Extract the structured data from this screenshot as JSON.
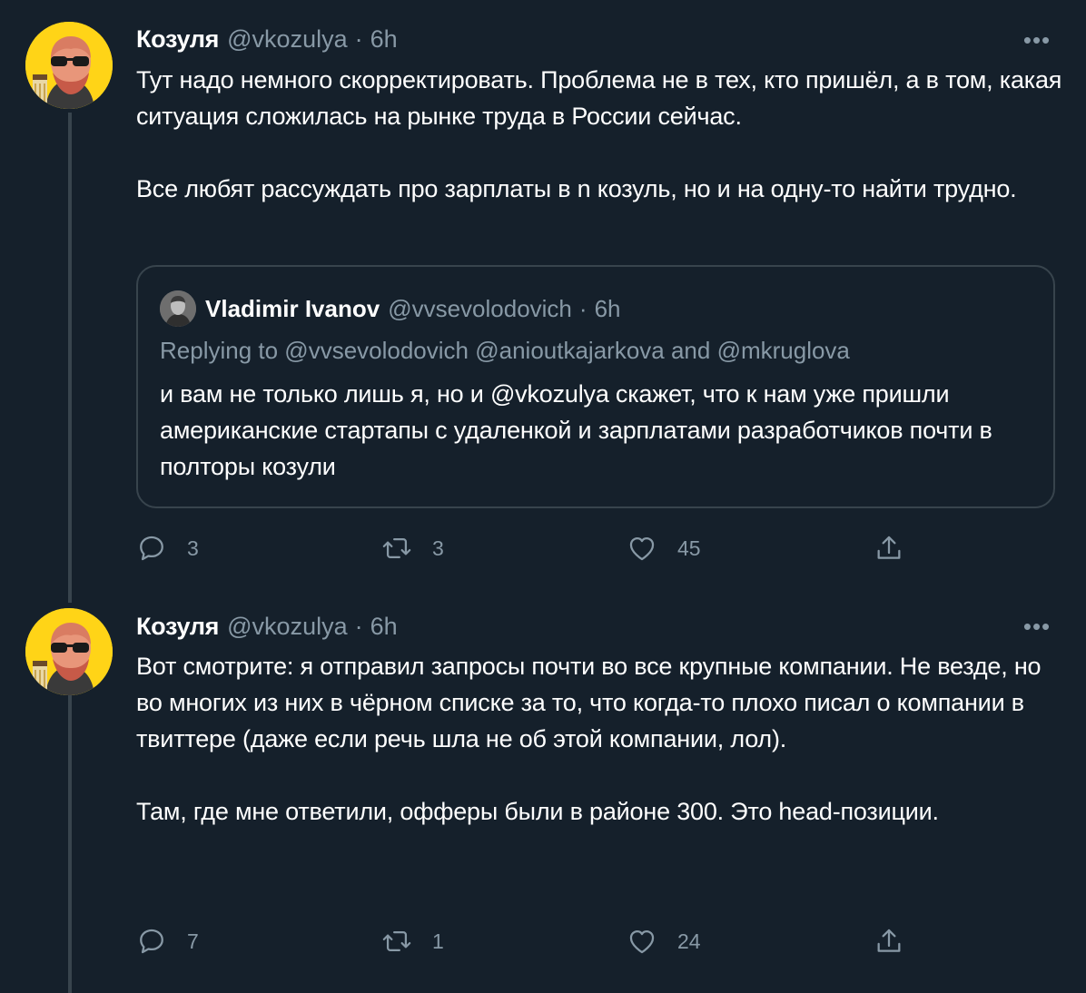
{
  "tweets": [
    {
      "author_name": "Козуля",
      "author_handle": "@vkozulya",
      "dot": "·",
      "time": "6h",
      "more_label": "•••",
      "paragraphs": [
        "Тут надо немного скорректировать. Проблема не в тех, кто пришёл, а в том, какая ситуация сложилась на рынке труда в России сейчас.",
        "Все любят рассуждать про зарплаты в n козуль, но и на одну-то найти трудно."
      ],
      "quote": {
        "author_name": "Vladimir Ivanov",
        "author_handle": "@vvsevolodovich",
        "dot": "·",
        "time": "6h",
        "replying_to": "Replying to @vvsevolodovich @anioutkajarkova and @mkruglova",
        "text": "и вам не только лишь я, но и @vkozulya скажет, что к нам уже пришли американские стартапы с удаленкой и зарплатами разработчиков почти в полторы козули"
      },
      "replies": "3",
      "retweets": "3",
      "likes": "45"
    },
    {
      "author_name": "Козуля",
      "author_handle": "@vkozulya",
      "dot": "·",
      "time": "6h",
      "more_label": "•••",
      "paragraphs": [
        "Вот смотрите: я отправил запросы почти во все крупные компании. Не везде, но во многих из них в чёрном списке за то, что когда-то плохо писал о компании в твиттере (даже если речь шла не об этой компании, лол).",
        "Там, где мне ответили, офферы были в районе 300. Это head-позиции."
      ],
      "replies": "7",
      "retweets": "1",
      "likes": "24"
    }
  ],
  "icons": {
    "reply": "reply-icon",
    "retweet": "retweet-icon",
    "like": "heart-icon",
    "share": "share-icon",
    "more": "more-icon"
  },
  "colors": {
    "background": "#15202b",
    "secondary_text": "#8899a6",
    "border": "#38444d",
    "avatar_bg": "#ffd417"
  }
}
